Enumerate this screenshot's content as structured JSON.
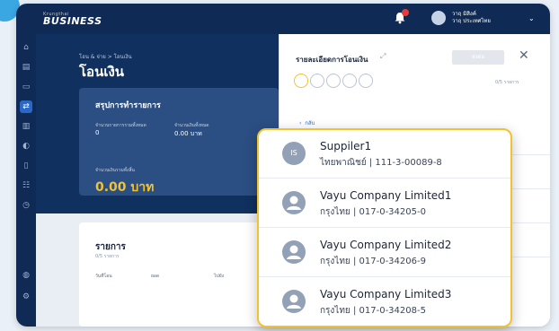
{
  "app": {
    "brand_small": "Krungthai",
    "brand": "BUSINESS"
  },
  "header": {
    "user_name": "วาฤ มิสิงค์",
    "user_company": "วาฤ ประเทศไทย"
  },
  "main": {
    "breadcrumb": "โอน & จ่าย > โอนเงิน",
    "title": "โอนเงิน",
    "summary": {
      "title": "สรุปการทำรายการ",
      "count_label": "จำนวนรายการรวมทั้งหมด",
      "count_value": "0",
      "amount_label": "จำนวนเงินทั้งหมด",
      "amount_value": "0.00 บาท",
      "net_label": "จำนวนเงินรวมทั้งสิ้น",
      "net_value": "0.00 บาท"
    },
    "list": {
      "title": "รายการ",
      "subtitle": "0/5 รายการ",
      "columns": [
        "วันที่โอน",
        "ยอด",
        "ไปยัง"
      ]
    }
  },
  "panel": {
    "title": "รายละเอียดการโอนเงิน",
    "submit_label": "ส่งต่อ",
    "count": "0/5 รายการ",
    "back_label": "กลับ"
  },
  "popup": {
    "items": [
      {
        "initials": "IS",
        "name": "Suppiler1",
        "detail": "ไทยพาณิชย์ | 111-3-00089-8"
      },
      {
        "initials": "",
        "name": "Vayu Company Limited1",
        "detail": "กรุงไทย | 017-0-34205-0"
      },
      {
        "initials": "",
        "name": "Vayu Company Limited2",
        "detail": "กรุงไทย | 017-0-34206-9"
      },
      {
        "initials": "",
        "name": "Vayu Company Limited3",
        "detail": "กรุงไทย | 017-0-34208-5"
      }
    ]
  },
  "icons": [
    "bell-icon",
    "user-avatar-icon",
    "chevron-down-icon",
    "home-icon",
    "expand-icon",
    "close-icon",
    "back-chevron-icon"
  ],
  "colors": {
    "navy": "#0e2a55",
    "accent": "#f2c230",
    "active": "#2a68c8"
  }
}
